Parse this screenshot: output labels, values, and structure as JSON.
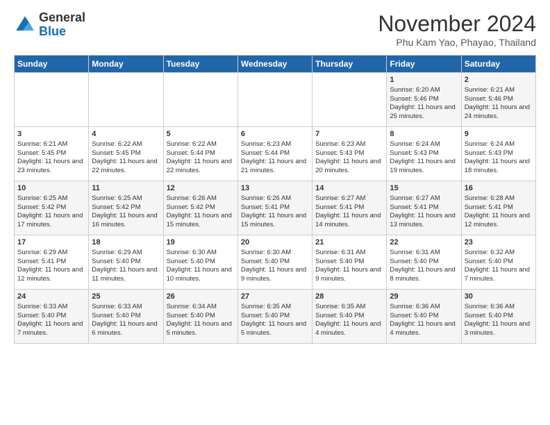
{
  "logo": {
    "general": "General",
    "blue": "Blue"
  },
  "title": "November 2024",
  "location": "Phu Kam Yao, Phayao, Thailand",
  "days_of_week": [
    "Sunday",
    "Monday",
    "Tuesday",
    "Wednesday",
    "Thursday",
    "Friday",
    "Saturday"
  ],
  "weeks": [
    [
      {
        "day": "",
        "info": ""
      },
      {
        "day": "",
        "info": ""
      },
      {
        "day": "",
        "info": ""
      },
      {
        "day": "",
        "info": ""
      },
      {
        "day": "",
        "info": ""
      },
      {
        "day": "1",
        "info": "Sunrise: 6:20 AM\nSunset: 5:46 PM\nDaylight: 11 hours and 25 minutes."
      },
      {
        "day": "2",
        "info": "Sunrise: 6:21 AM\nSunset: 5:46 PM\nDaylight: 11 hours and 24 minutes."
      }
    ],
    [
      {
        "day": "3",
        "info": "Sunrise: 6:21 AM\nSunset: 5:45 PM\nDaylight: 11 hours and 23 minutes."
      },
      {
        "day": "4",
        "info": "Sunrise: 6:22 AM\nSunset: 5:45 PM\nDaylight: 11 hours and 22 minutes."
      },
      {
        "day": "5",
        "info": "Sunrise: 6:22 AM\nSunset: 5:44 PM\nDaylight: 11 hours and 22 minutes."
      },
      {
        "day": "6",
        "info": "Sunrise: 6:23 AM\nSunset: 5:44 PM\nDaylight: 11 hours and 21 minutes."
      },
      {
        "day": "7",
        "info": "Sunrise: 6:23 AM\nSunset: 5:43 PM\nDaylight: 11 hours and 20 minutes."
      },
      {
        "day": "8",
        "info": "Sunrise: 6:24 AM\nSunset: 5:43 PM\nDaylight: 11 hours and 19 minutes."
      },
      {
        "day": "9",
        "info": "Sunrise: 6:24 AM\nSunset: 5:43 PM\nDaylight: 11 hours and 18 minutes."
      }
    ],
    [
      {
        "day": "10",
        "info": "Sunrise: 6:25 AM\nSunset: 5:42 PM\nDaylight: 11 hours and 17 minutes."
      },
      {
        "day": "11",
        "info": "Sunrise: 6:25 AM\nSunset: 5:42 PM\nDaylight: 11 hours and 16 minutes."
      },
      {
        "day": "12",
        "info": "Sunrise: 6:26 AM\nSunset: 5:42 PM\nDaylight: 11 hours and 15 minutes."
      },
      {
        "day": "13",
        "info": "Sunrise: 6:26 AM\nSunset: 5:41 PM\nDaylight: 11 hours and 15 minutes."
      },
      {
        "day": "14",
        "info": "Sunrise: 6:27 AM\nSunset: 5:41 PM\nDaylight: 11 hours and 14 minutes."
      },
      {
        "day": "15",
        "info": "Sunrise: 6:27 AM\nSunset: 5:41 PM\nDaylight: 11 hours and 13 minutes."
      },
      {
        "day": "16",
        "info": "Sunrise: 6:28 AM\nSunset: 5:41 PM\nDaylight: 11 hours and 12 minutes."
      }
    ],
    [
      {
        "day": "17",
        "info": "Sunrise: 6:29 AM\nSunset: 5:41 PM\nDaylight: 11 hours and 12 minutes."
      },
      {
        "day": "18",
        "info": "Sunrise: 6:29 AM\nSunset: 5:40 PM\nDaylight: 11 hours and 11 minutes."
      },
      {
        "day": "19",
        "info": "Sunrise: 6:30 AM\nSunset: 5:40 PM\nDaylight: 11 hours and 10 minutes."
      },
      {
        "day": "20",
        "info": "Sunrise: 6:30 AM\nSunset: 5:40 PM\nDaylight: 11 hours and 9 minutes."
      },
      {
        "day": "21",
        "info": "Sunrise: 6:31 AM\nSunset: 5:40 PM\nDaylight: 11 hours and 9 minutes."
      },
      {
        "day": "22",
        "info": "Sunrise: 6:31 AM\nSunset: 5:40 PM\nDaylight: 11 hours and 8 minutes."
      },
      {
        "day": "23",
        "info": "Sunrise: 6:32 AM\nSunset: 5:40 PM\nDaylight: 11 hours and 7 minutes."
      }
    ],
    [
      {
        "day": "24",
        "info": "Sunrise: 6:33 AM\nSunset: 5:40 PM\nDaylight: 11 hours and 7 minutes."
      },
      {
        "day": "25",
        "info": "Sunrise: 6:33 AM\nSunset: 5:40 PM\nDaylight: 11 hours and 6 minutes."
      },
      {
        "day": "26",
        "info": "Sunrise: 6:34 AM\nSunset: 5:40 PM\nDaylight: 11 hours and 5 minutes."
      },
      {
        "day": "27",
        "info": "Sunrise: 6:35 AM\nSunset: 5:40 PM\nDaylight: 11 hours and 5 minutes."
      },
      {
        "day": "28",
        "info": "Sunrise: 6:35 AM\nSunset: 5:40 PM\nDaylight: 11 hours and 4 minutes."
      },
      {
        "day": "29",
        "info": "Sunrise: 6:36 AM\nSunset: 5:40 PM\nDaylight: 11 hours and 4 minutes."
      },
      {
        "day": "30",
        "info": "Sunrise: 6:36 AM\nSunset: 5:40 PM\nDaylight: 11 hours and 3 minutes."
      }
    ]
  ]
}
